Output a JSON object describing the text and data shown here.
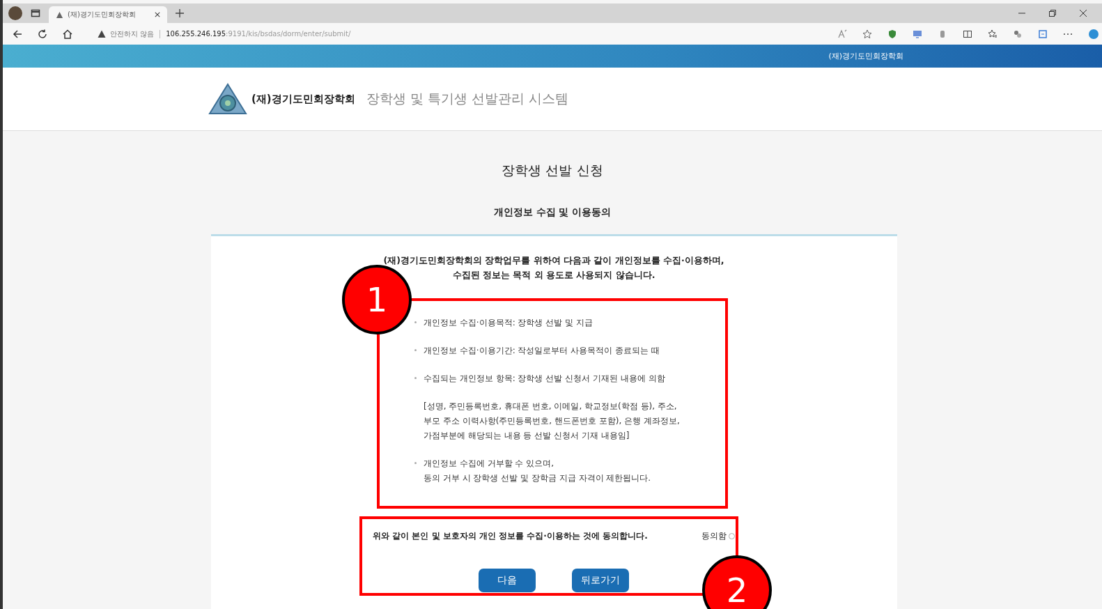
{
  "browser": {
    "tab": {
      "title": "(재)경기도민회장학회",
      "selected": true
    },
    "security": "안전하지 않음",
    "url_host": "106.255.246.195",
    "url_path": ":9191/kis/bsdas/dorm/enter/submit/"
  },
  "top_bar": {
    "title": "(재)경기도민회장학회"
  },
  "header": {
    "org": "(재)경기도민회장학회",
    "system": "장학생 및 특기생 선발관리 시스템"
  },
  "page": {
    "title": "장학생 선발 신청",
    "subtitle": "개인정보 수집 및 이용동의"
  },
  "consent": {
    "intro": [
      "(재)경기도민회장학회의 장학업무를 위하여 다음과 같이 개인정보를 수집·이용하며,",
      "수집된 정보는 목적 외 용도로 사용되지 않습니다."
    ],
    "items": [
      {
        "kind": "bullet",
        "lines": [
          "개인정보 수집·이용목적: 장학생 선발 및 지급"
        ]
      },
      {
        "kind": "bullet",
        "lines": [
          "개인정보 수집·이용기간: 작성일로부터 사용목적이 종료되는 때"
        ]
      },
      {
        "kind": "bullet",
        "lines": [
          "수집되는 개인정보 항목: 장학생 선발 신청서 기재된 내용에 의함"
        ]
      },
      {
        "kind": "note",
        "lines": [
          "[성명, 주민등록번호, 휴대폰 번호, 이메일, 학교정보(학점 등), 주소,",
          "부모 주소 이력사항(주민등록번호, 핸드폰번호 포함), 은행 계좌정보,",
          "가점부분에 해당되는 내용 등 선발 신청서 기재 내용임]"
        ]
      },
      {
        "kind": "bullet",
        "lines": [
          "개인정보 수집에 거부할 수 있으며,",
          "동의 거부 시 장학생 선발 및 장학금 지급 자격이 제한됩니다."
        ]
      }
    ],
    "agreement": "위와 같이 본인 및 보호자의 개인 정보를 수집·이용하는 것에 동의합니다.",
    "agree": {
      "label": "동의함",
      "checked": false
    },
    "buttons": [
      "다음",
      "뒤로가기"
    ]
  },
  "annotations": [
    {
      "label": "1"
    },
    {
      "label": "2"
    }
  ]
}
